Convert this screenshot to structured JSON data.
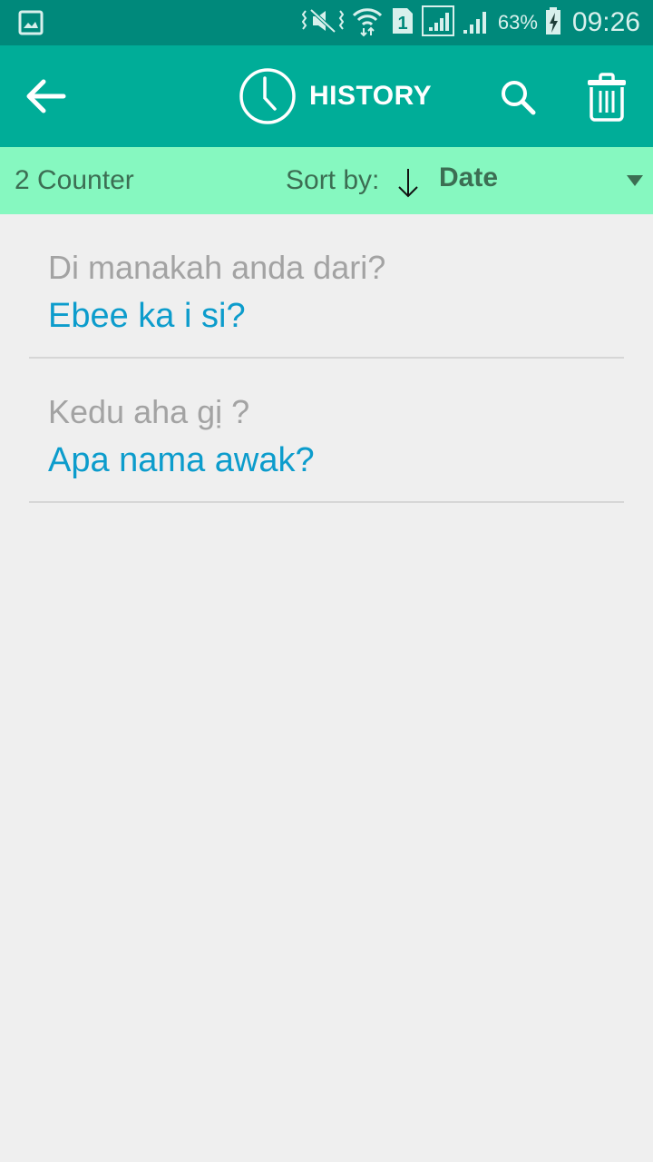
{
  "status_bar": {
    "icons": [
      "gallery-notification-icon",
      "vibrate-mute-icon",
      "wifi-data-icon",
      "sim-1-icon",
      "signal-sim1-icon",
      "signal-sim2-icon",
      "battery-charging-icon"
    ],
    "battery": "63%",
    "time": "09:26"
  },
  "app_bar": {
    "back_icon": "arrow-left-icon",
    "title_icon": "clock-icon",
    "title": "HISTORY",
    "search_icon": "search-icon",
    "delete_icon": "trash-icon",
    "background_color": "#00ad98"
  },
  "sort_bar": {
    "counter": "2 Counter",
    "sort_label": "Sort by:",
    "sort_direction": "descending",
    "sort_value": "Date",
    "background_color": "#86f8c0"
  },
  "history": {
    "items": [
      {
        "source": "Di manakah anda dari?",
        "translation": "Ebee ka i si?"
      },
      {
        "source": "Kedu aha gị ?",
        "translation": "Apa nama awak?"
      }
    ],
    "source_color": "#a3a3a3",
    "translation_color": "#0c9ccc"
  }
}
